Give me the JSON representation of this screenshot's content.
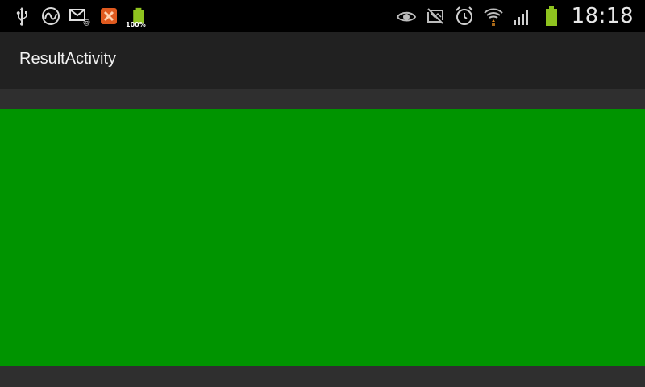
{
  "status_bar": {
    "left_icons": [
      "usb-icon",
      "sync-icon",
      "email-icon",
      "app-icon",
      "battery-full-icon"
    ],
    "battery_label": "100%",
    "right_icons": [
      "eye-icon",
      "no-sim-icon",
      "alarm-icon",
      "wifi-icon",
      "signal-icon",
      "battery-icon"
    ],
    "time": "18:18"
  },
  "action_bar": {
    "title": "ResultActivity"
  },
  "colors": {
    "result_panel": "#009400",
    "status_bar": "#000000",
    "action_bar": "#212121",
    "battery": "#8fc31f"
  }
}
